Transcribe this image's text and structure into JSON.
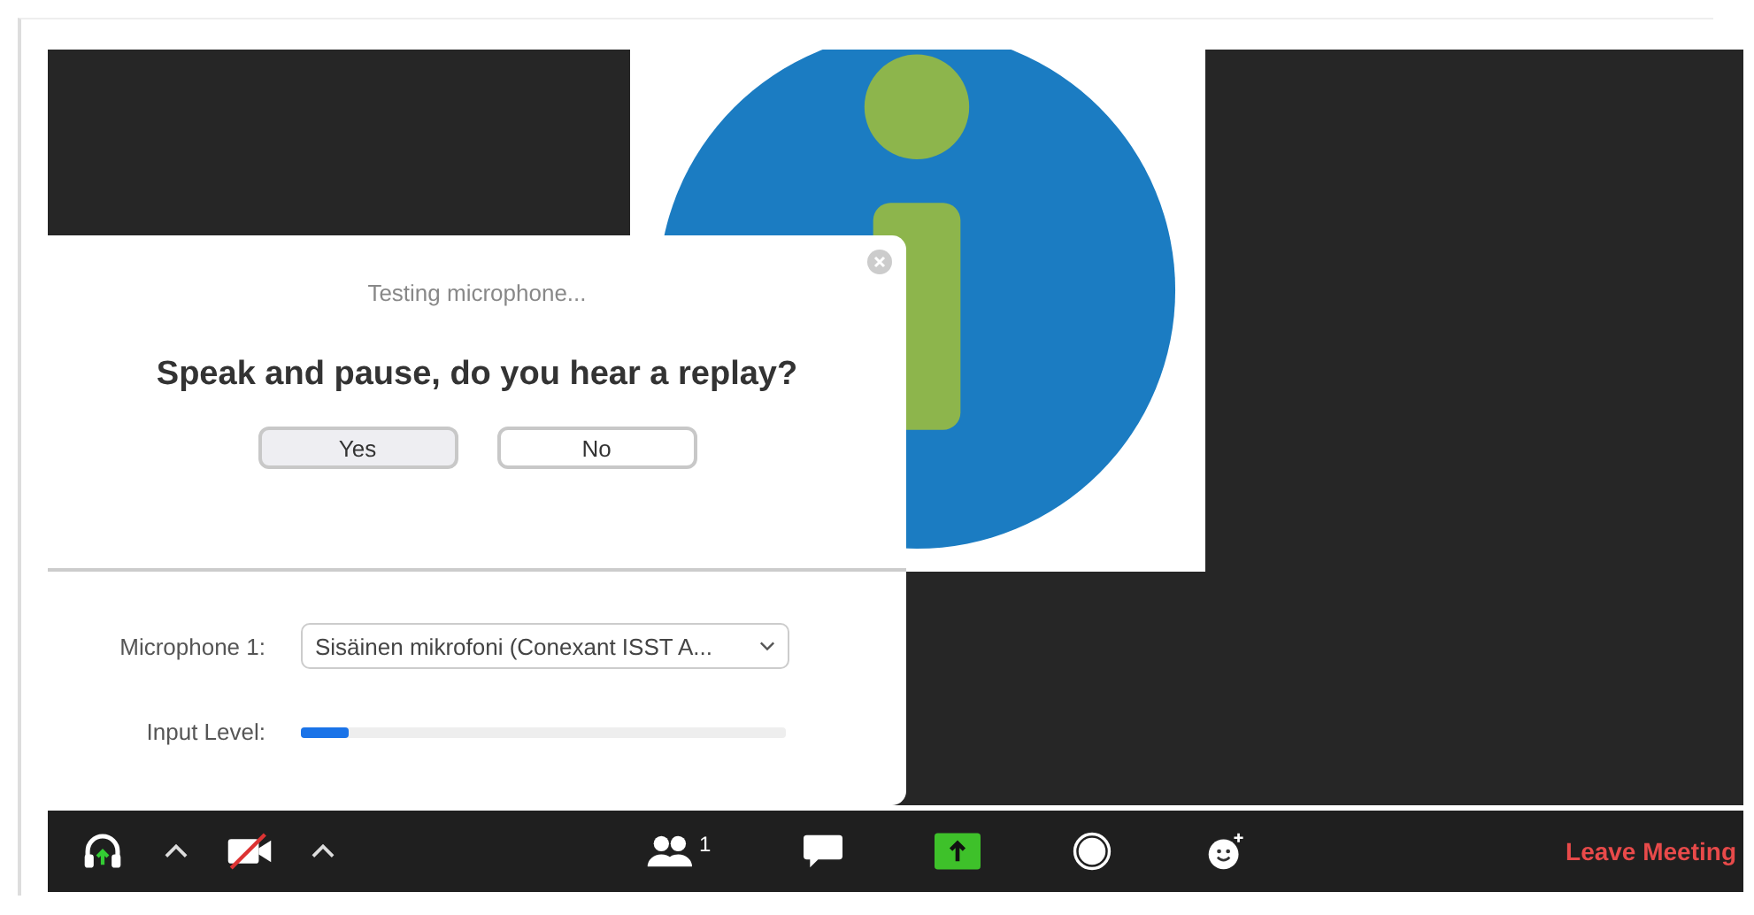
{
  "dialog": {
    "status": "Testing microphone...",
    "question": "Speak and pause, do you hear a replay?",
    "buttons": [
      {
        "label": "Yes",
        "selected": true
      },
      {
        "label": "No",
        "selected": false
      }
    ],
    "microphone": {
      "label": "Microphone 1:",
      "value": "Sisäinen mikrofoni (Conexant ISST A..."
    },
    "input_level": {
      "label": "Input Level:",
      "level": 0.1
    }
  },
  "toolbar": {
    "participants_count": "1",
    "leave": "Leave Meeting"
  }
}
